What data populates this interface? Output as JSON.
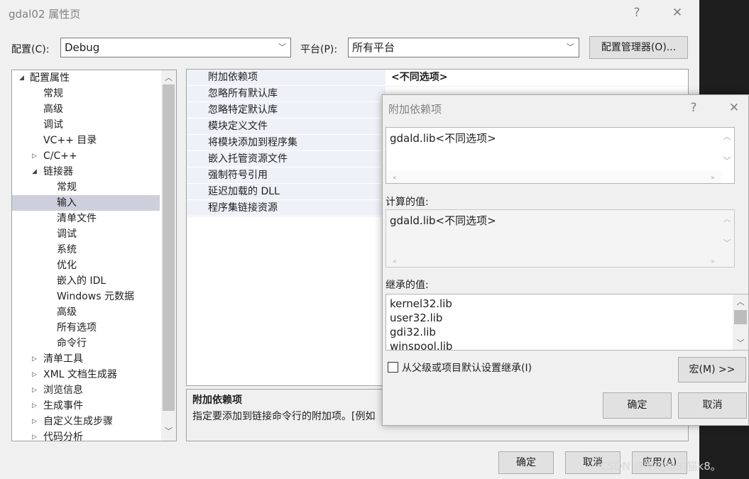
{
  "main_window": {
    "title": "gdal02 属性页",
    "help_glyph": "?",
    "close_glyph": "✕",
    "config_label": "配置(C):",
    "config_value": "Debug",
    "platform_label": "平台(P):",
    "platform_value": "所有平台",
    "config_manager_button": "配置管理器(O)...",
    "ok_button": "确定",
    "cancel_button": "取消",
    "apply_button": "应用(A)"
  },
  "tree": {
    "items": [
      {
        "label": "配置属性",
        "expander": "◢"
      },
      {
        "label": "常规"
      },
      {
        "label": "高级"
      },
      {
        "label": "调试"
      },
      {
        "label": "VC++ 目录"
      },
      {
        "label": "C/C++",
        "expander": "▷"
      },
      {
        "label": "链接器",
        "expander": "◢"
      },
      {
        "label": "常规"
      },
      {
        "label": "输入"
      },
      {
        "label": "清单文件"
      },
      {
        "label": "调试"
      },
      {
        "label": "系统"
      },
      {
        "label": "优化"
      },
      {
        "label": "嵌入的 IDL"
      },
      {
        "label": "Windows 元数据"
      },
      {
        "label": "高级"
      },
      {
        "label": "所有选项"
      },
      {
        "label": "命令行"
      },
      {
        "label": "清单工具",
        "expander": "▷"
      },
      {
        "label": "XML 文档生成器",
        "expander": "▷"
      },
      {
        "label": "浏览信息",
        "expander": "▷"
      },
      {
        "label": "生成事件",
        "expander": "▷"
      },
      {
        "label": "自定义生成步骤",
        "expander": "▷"
      },
      {
        "label": "代码分析",
        "expander": "▷"
      }
    ],
    "selected": "输入"
  },
  "properties": {
    "rows": [
      {
        "name": "附加依赖项",
        "value": "<不同选项>"
      },
      {
        "name": "忽略所有默认库",
        "value": ""
      },
      {
        "name": "忽略特定默认库",
        "value": ""
      },
      {
        "name": "模块定义文件",
        "value": ""
      },
      {
        "name": "将模块添加到程序集",
        "value": ""
      },
      {
        "name": "嵌入托管资源文件",
        "value": ""
      },
      {
        "name": "强制符号引用",
        "value": ""
      },
      {
        "name": "延迟加载的 DLL",
        "value": ""
      },
      {
        "name": "程序集链接资源",
        "value": ""
      }
    ],
    "description_title": "附加依赖项",
    "description_text": "指定要添加到链接命令行的附加项。[例如"
  },
  "dialog": {
    "title": "附加依赖项",
    "help_glyph": "?",
    "close_glyph": "✕",
    "edit_value": "gdald.lib<不同选项>",
    "computed_label": "计算的值:",
    "computed_value": "gdald.lib<不同选项>",
    "inherited_label": "继承的值:",
    "inherited_values": [
      "kernel32.lib",
      "user32.lib",
      "gdi32.lib",
      "winspool.lib"
    ],
    "inherit_checkbox_label": "从父级或项目默认设置继承(I)",
    "inherit_checked": false,
    "macro_button": "宏(M) >>",
    "ok_button": "确定",
    "cancel_button": "取消"
  },
  "watermark": "CSDN @不吃鱼的猫k8。",
  "colors": {
    "window_bg": "#f0f0f0",
    "selection": "#cdd0dc",
    "button_bg": "#e1e1e1",
    "dark_bg": "#1e1e1e"
  }
}
